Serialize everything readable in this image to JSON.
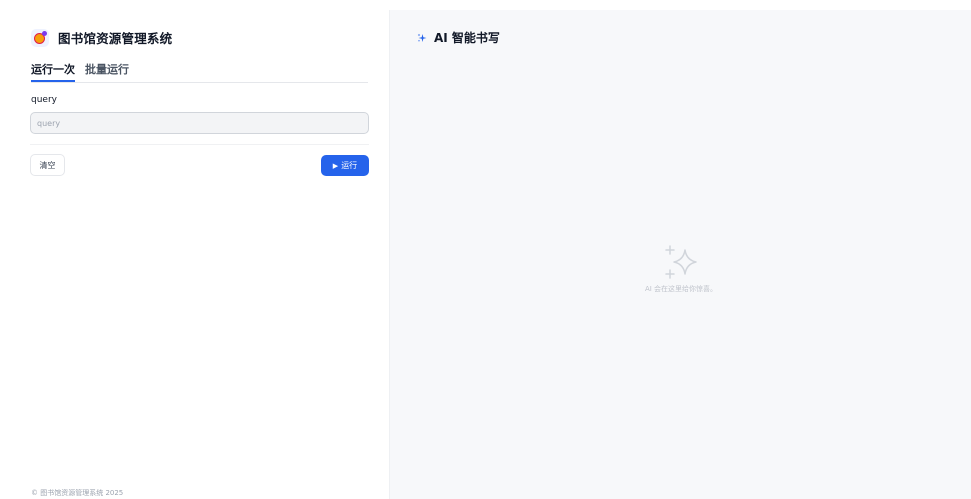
{
  "app": {
    "title": "图书馆资源管理系统",
    "logo_icon": "app-logo-icon"
  },
  "tabs": [
    {
      "label": "运行一次",
      "active": true
    },
    {
      "label": "批量运行",
      "active": false
    }
  ],
  "form": {
    "query_label": "query",
    "query_placeholder": "query",
    "query_value": ""
  },
  "actions": {
    "clear_label": "清空",
    "run_icon": "▶",
    "run_label": "运行"
  },
  "footer": {
    "copyright": "© 图书馆资源管理系统 2025"
  },
  "ai_panel": {
    "title": "AI 智能书写",
    "title_icon": "sparkle-icon",
    "empty_icon": "sparkle-large-icon",
    "empty_text": "AI 会在这里给你惊喜。"
  },
  "colors": {
    "accent": "#2563eb",
    "panel_background": "#f7f8fa",
    "muted_text": "#9ca3af"
  }
}
